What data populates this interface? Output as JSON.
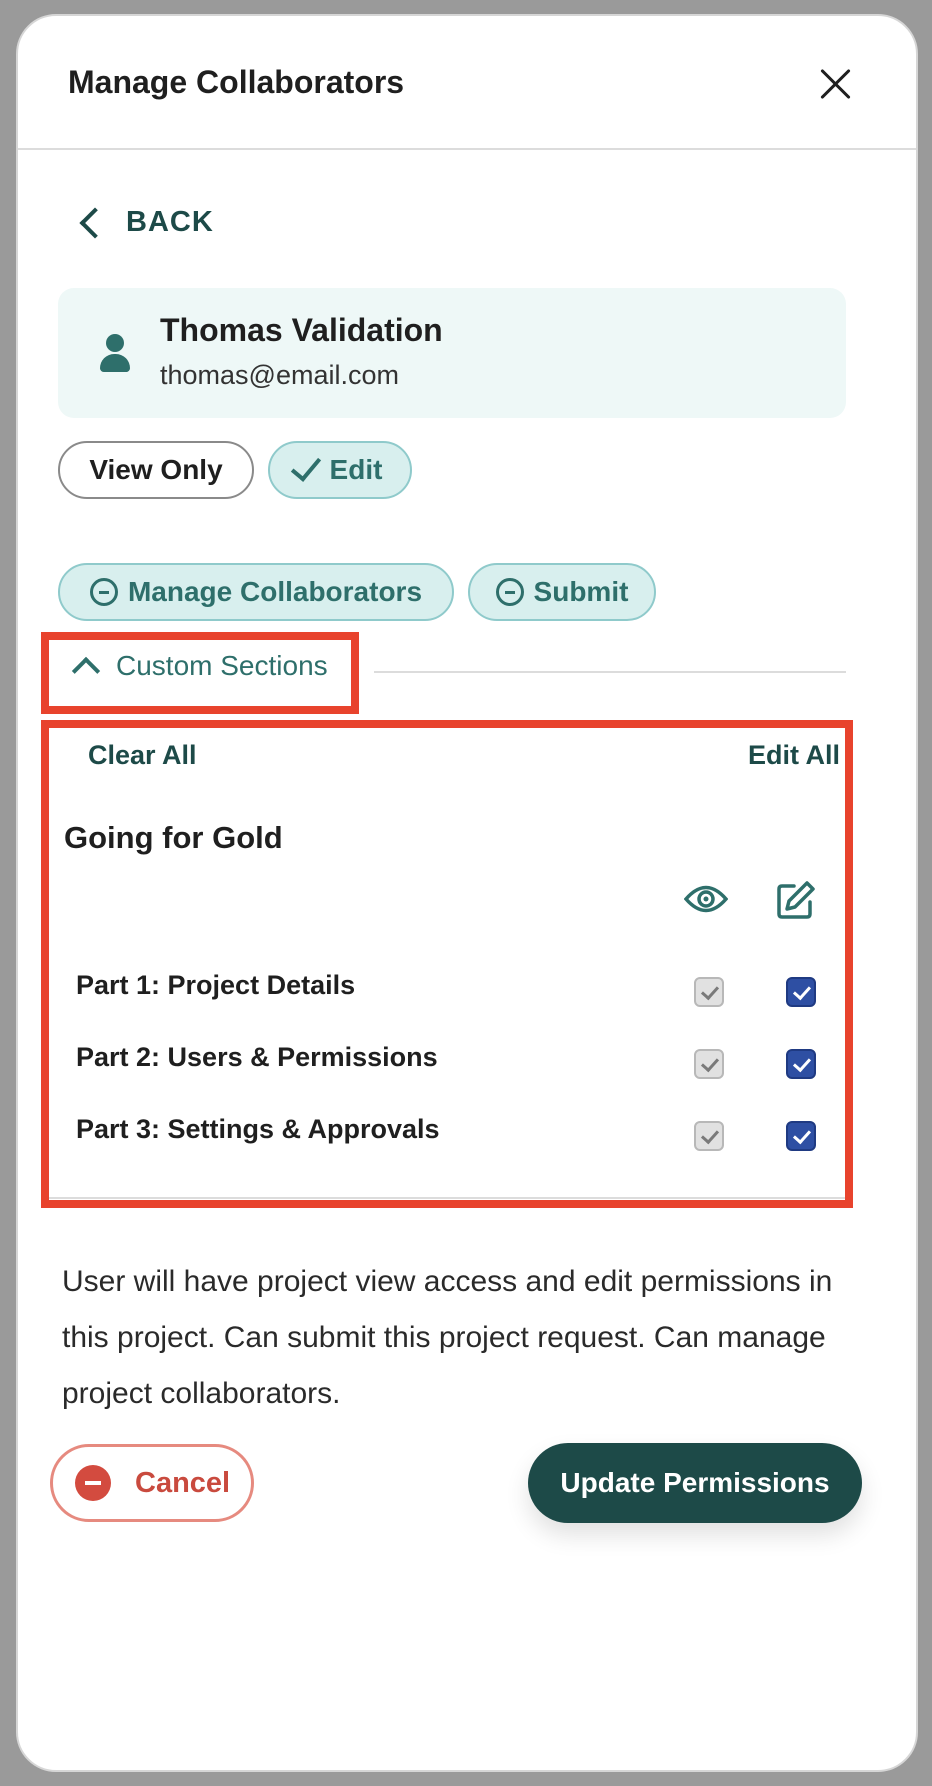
{
  "modal": {
    "title": "Manage Collaborators"
  },
  "back_label": "BACK",
  "user": {
    "name": "Thomas Validation",
    "email": "thomas@email.com"
  },
  "access_options": {
    "view_only": "View Only",
    "edit": "Edit",
    "edit_selected": true
  },
  "permissions": {
    "manage_collaborators": "Manage Collaborators",
    "submit": "Submit"
  },
  "custom_sections": {
    "toggle_label": "Custom Sections",
    "expanded": true,
    "clear_all": "Clear All",
    "edit_all": "Edit All",
    "section_title": "Going for Gold",
    "rows": [
      {
        "label": "Part 1: Project Details",
        "view": true,
        "edit": true
      },
      {
        "label": "Part 2: Users & Permissions",
        "view": true,
        "edit": true
      },
      {
        "label": "Part 3: Settings & Approvals",
        "view": true,
        "edit": true
      }
    ]
  },
  "description": "User will have project view access and edit permissions in this project. Can submit this project request. Can manage project collaborators.",
  "actions": {
    "cancel": "Cancel",
    "update": "Update Permissions"
  },
  "colors": {
    "primary_dark": "#1d4a48",
    "accent_teal": "#2e6f6b",
    "chip_bg": "#d8efee",
    "highlight_red": "#e8432d",
    "checkbox_blue": "#2e4fa3",
    "cancel_red": "#d34b3f"
  }
}
